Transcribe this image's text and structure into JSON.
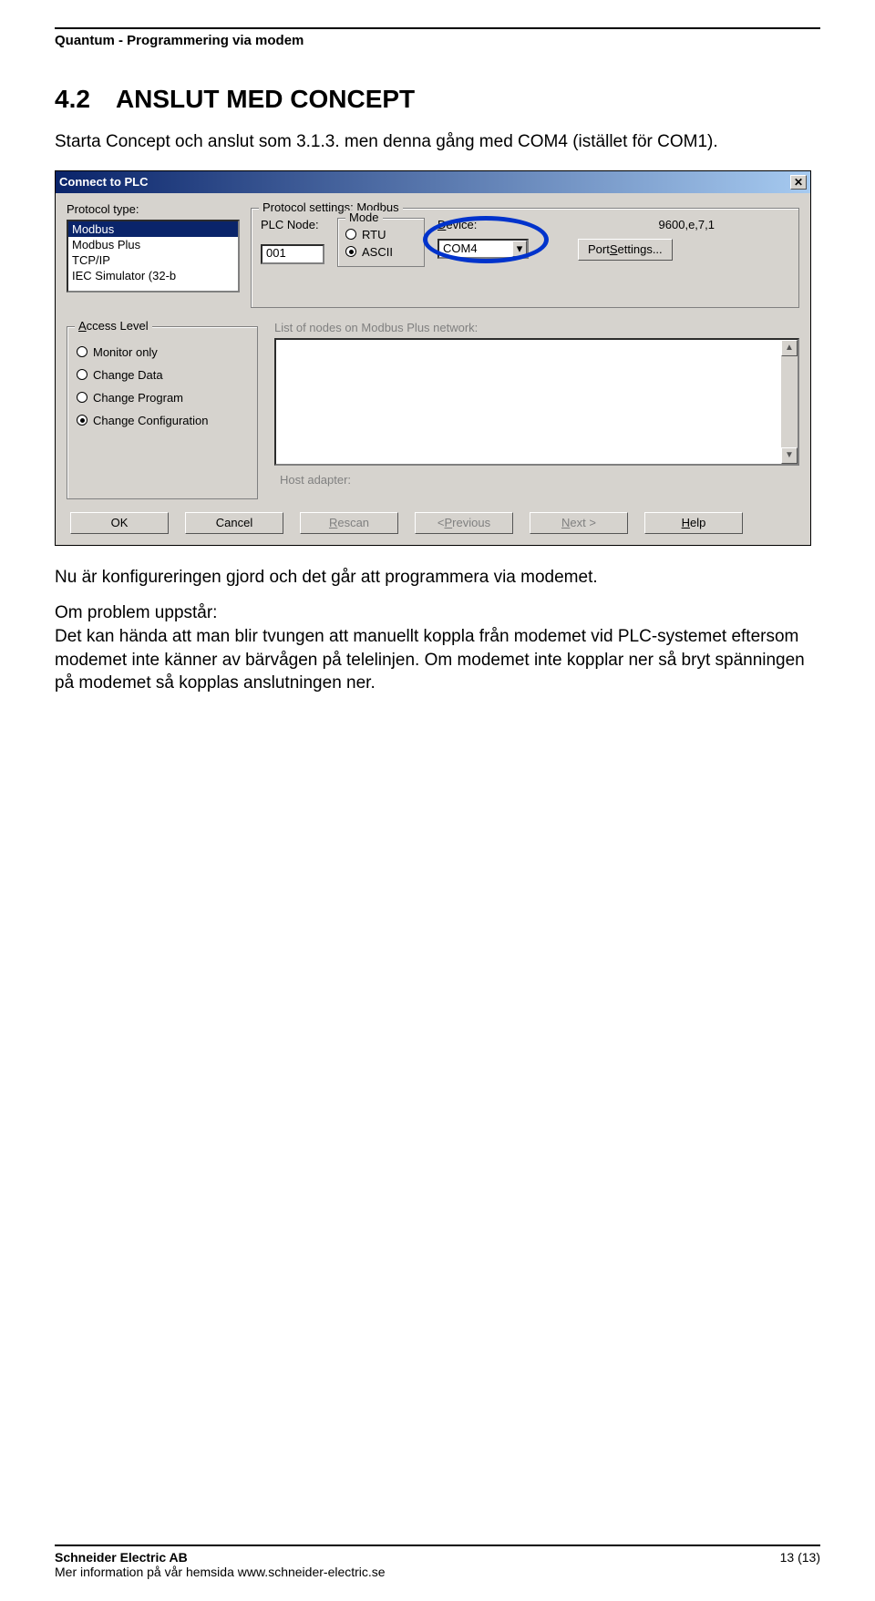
{
  "doc_header": "Quantum - Programmering via modem",
  "section": {
    "number": "4.2",
    "title": "ANSLUT MED CONCEPT"
  },
  "intro_para": "Starta Concept och anslut som 3.1.3. men denna gång med COM4 (istället för COM1).",
  "dialog": {
    "title": "Connect to PLC",
    "close_glyph": "✕",
    "labels": {
      "protocol_type": "Protocol type:",
      "protocol_settings": "Protocol settings: Modbus",
      "plc_node": "PLC Node:",
      "mode": "Mode",
      "device": "Device:",
      "access_level": "Access Level",
      "nodes_list": "List of nodes on Modbus Plus network:",
      "host_adapter": "Host adapter:"
    },
    "protocol_list": [
      "Modbus",
      "Modbus Plus",
      "TCP/IP",
      "IEC Simulator (32-b"
    ],
    "protocol_selected_index": 0,
    "plc_node_value": "001",
    "mode_options": {
      "rtu": "RTU",
      "ascii": "ASCII"
    },
    "mode_selected": "ascii",
    "device_value": "COM4",
    "port_info": "9600,e,7,1",
    "port_settings_btn": "Port Settings...",
    "access_options": [
      "Monitor only",
      "Change Data",
      "Change Program",
      "Change Configuration"
    ],
    "access_selected_index": 3,
    "buttons": {
      "ok": "OK",
      "cancel": "Cancel",
      "rescan": "Rescan",
      "previous": "< Previous",
      "next": "Next >",
      "help": "Help"
    }
  },
  "post_para1": "Nu är konfigureringen gjord och det går att programmera via modemet.",
  "post_para2": "Om problem uppstår:\nDet kan hända att man blir tvungen att manuellt koppla från modemet vid PLC-systemet eftersom modemet inte känner av bärvågen på telelinjen. Om modemet inte kopplar ner så bryt spänningen på modemet så kopplas anslutningen ner.",
  "footer": {
    "company": "Schneider Electric AB",
    "info_line": "Mer information på vår hemsida www.schneider-electric.se",
    "page": "13 (13)"
  }
}
